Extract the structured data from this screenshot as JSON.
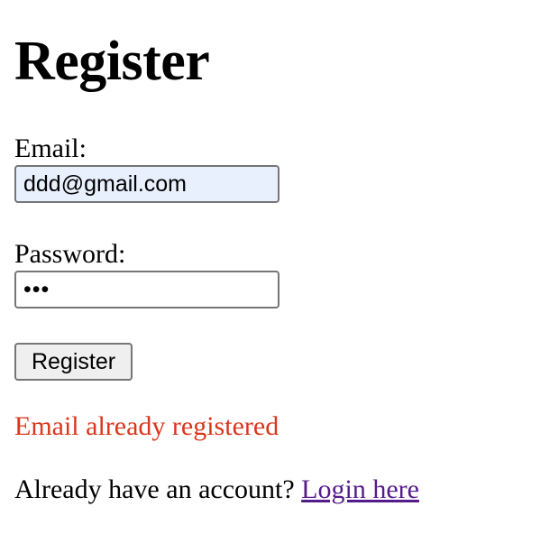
{
  "page": {
    "title": "Register"
  },
  "form": {
    "email_label": "Email:",
    "email_value": "ddd@gmail.com",
    "password_label": "Password:",
    "password_value": "abc",
    "submit_label": "Register"
  },
  "status": {
    "error_message": "Email already registered"
  },
  "footer": {
    "prompt_text": "Already have an account?",
    "login_link_label": "Login here"
  },
  "colors": {
    "error": "#d9371c",
    "visited_link": "#551a8b",
    "autofill_background": "#e8f0fe"
  }
}
